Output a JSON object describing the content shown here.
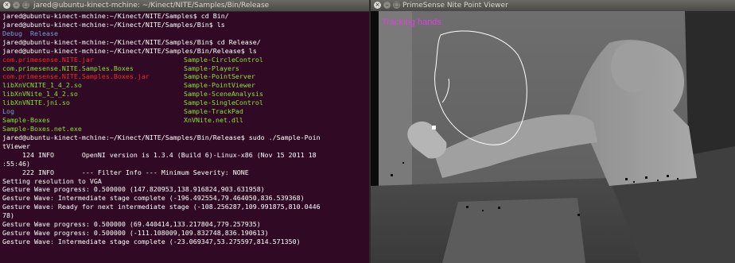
{
  "terminal": {
    "title": "jared@ubuntu-kinect-mchine: ~/Kinect/NITE/Samples/Bin/Release",
    "lines_top": [
      {
        "text": "jared@ubuntu-kinect-mchine:~/Kinect/NITE/Samples$ cd Bin/",
        "color": "white"
      },
      {
        "text": "jared@ubuntu-kinect-mchine:~/Kinect/NITE/Samples/Bin$ ls",
        "color": "white"
      }
    ],
    "dirs_line": [
      "Debug",
      "Release"
    ],
    "lines_mid": [
      {
        "text": "jared@ubuntu-kinect-mchine:~/Kinect/NITE/Samples/Bin$ cd Release/",
        "color": "white"
      },
      {
        "text": "jared@ubuntu-kinect-mchine:~/Kinect/NITE/Samples/Bin/Release$ ls",
        "color": "white"
      }
    ],
    "ls_rows": [
      {
        "left": "com.primesense.NITE.jar",
        "left_color": "red",
        "right": "Sample-CircleControl",
        "right_color": "green"
      },
      {
        "left": "com.primesense.NITE.Samples.Boxes",
        "left_color": "green",
        "right": "Sample-Players",
        "right_color": "green"
      },
      {
        "left": "com.primesense.NITE.Samples.Boxes.jar",
        "left_color": "red",
        "right": "Sample-PointServer",
        "right_color": "green"
      },
      {
        "left": "libXnVCNITE_1_4_2.so",
        "left_color": "green",
        "right": "Sample-PointViewer",
        "right_color": "green"
      },
      {
        "left": "libXnVNite_1_4_2.so",
        "left_color": "green",
        "right": "Sample-SceneAnalysis",
        "right_color": "green"
      },
      {
        "left": "libXnVNITE.jni.so",
        "left_color": "green",
        "right": "Sample-SingleControl",
        "right_color": "green"
      },
      {
        "left": "Log",
        "left_color": "blue",
        "right": "Sample-TrackPad",
        "right_color": "green"
      },
      {
        "left": "Sample-Boxes",
        "left_color": "green",
        "right": "XnVNite.net.dll",
        "right_color": "green"
      },
      {
        "left": "Sample-Boxes.net.exe",
        "left_color": "green",
        "right": "",
        "right_color": "green"
      }
    ],
    "lines_bottom": [
      "jared@ubuntu-kinect-mchine:~/Kinect/NITE/Samples/Bin/Release$ sudo ./Sample-Poin",
      "tViewer",
      "     124 INFO       OpenNI version is 1.3.4 (Build 6)-Linux-x86 (Nov 15 2011 18",
      ":55:46)",
      "     222 INFO       --- Filter Info --- Minimum Severity: NONE",
      "Setting resolution to VGA",
      "Gesture Wave progress: 0.500000 (147.820953,138.916824,903.631958)",
      "Gesture Wave: Intermediate stage complete (-196.492554,79.464050,836.539368)",
      "Gesture Wave: Ready for next intermediate stage (-108.256287,109.991875,810.0446",
      "78)",
      "Gesture Wave progress: 0.500000 (69.440414,133.217804,779.257935)",
      "Gesture Wave progress: 0.500000 (-111.108009,109.832748,836.190613)",
      "Gesture Wave: Intermediate stage complete (-23.069347,53.275597,814.571350)"
    ]
  },
  "viewer": {
    "title": "PrimeSense Nite Point Viewer",
    "overlay_text": "Tracking hands",
    "overlay_color": "#e040e0",
    "trail_color": "#ffffff"
  },
  "window_controls": {
    "close": "×",
    "minimize": "–",
    "maximize": "□"
  }
}
